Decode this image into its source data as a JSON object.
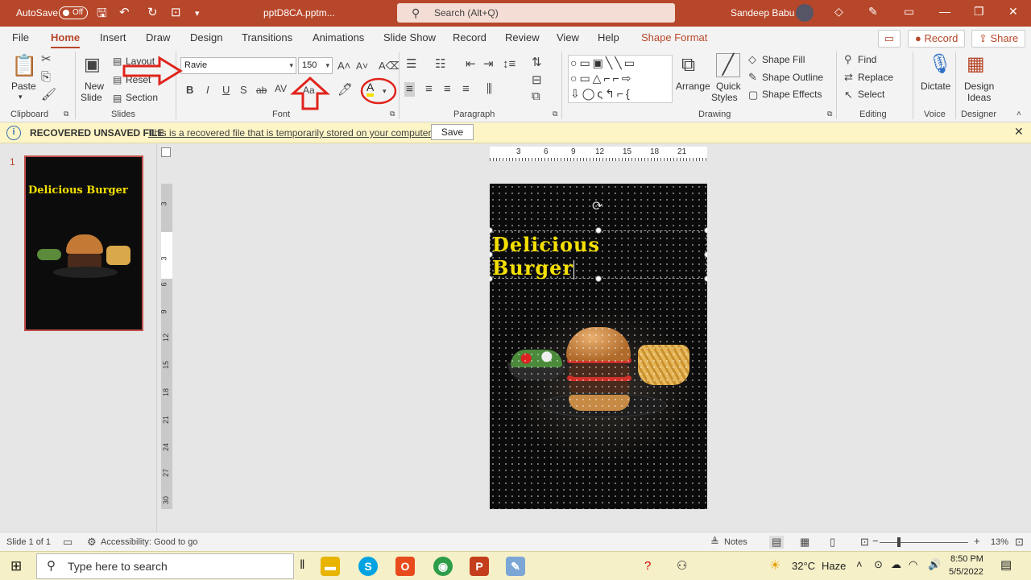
{
  "titlebar": {
    "autosave_label": "AutoSave",
    "autosave_state": "Off",
    "filename": "pptD8CA.pptm...",
    "search_placeholder": "Search (Alt+Q)",
    "user_name": "Sandeep Babu"
  },
  "tabs": [
    "File",
    "Home",
    "Insert",
    "Draw",
    "Design",
    "Transitions",
    "Animations",
    "Slide Show",
    "Record",
    "Review",
    "View",
    "Help",
    "Shape Format"
  ],
  "tab_actions": {
    "record": "Record",
    "share": "Share"
  },
  "ribbon": {
    "clipboard": {
      "paste": "Paste",
      "label": "Clipboard"
    },
    "slides": {
      "new_slide_1": "New",
      "new_slide_2": "Slide",
      "layout": "Layout",
      "reset": "Reset",
      "section": "Section",
      "label": "Slides"
    },
    "font": {
      "font_name": "Ravie",
      "font_size": "150",
      "label": "Font",
      "bold": "B",
      "italic": "I",
      "underline": "U",
      "shadow": "S",
      "strike": "ab",
      "spacing": "AV",
      "case": "Aa",
      "grow": "A^",
      "shrink": "Aˇ"
    },
    "paragraph": {
      "label": "Paragraph"
    },
    "drawing": {
      "arrange": "Arrange",
      "quick_styles_1": "Quick",
      "quick_styles_2": "Styles",
      "shape_fill": "Shape Fill",
      "shape_outline": "Shape Outline",
      "shape_effects": "Shape Effects",
      "label": "Drawing"
    },
    "editing": {
      "find": "Find",
      "replace": "Replace",
      "select": "Select",
      "label": "Editing"
    },
    "voice": {
      "dictate": "Dictate",
      "label": "Voice"
    },
    "designer": {
      "design_ideas_1": "Design",
      "design_ideas_2": "Ideas",
      "label": "Designer"
    }
  },
  "notification": {
    "title": "RECOVERED UNSAVED FILE",
    "message": "This is a recovered file that is temporarily stored on your computer.",
    "save": "Save"
  },
  "thumbnail": {
    "number": "1",
    "title": "Delicious Burger"
  },
  "hruler_numbers": [
    "3",
    "6",
    "9",
    "12",
    "15",
    "18",
    "21"
  ],
  "vruler_numbers": [
    "3",
    "3",
    "6",
    "9",
    "12",
    "15",
    "18",
    "21",
    "24",
    "27",
    "30"
  ],
  "slide": {
    "title_line1": "Delicious",
    "title_line2": "Burger"
  },
  "status": {
    "slide_info": "Slide 1 of 1",
    "accessibility": "Accessibility: Good to go",
    "notes": "Notes",
    "zoom": "13%"
  },
  "taskbar": {
    "search_placeholder": "Type here to search",
    "temperature": "32°C",
    "weather": "Haze",
    "time": "8:50 PM",
    "date": "5/5/2022"
  },
  "colors": {
    "accent": "#b7472a",
    "title_text": "#f5e000",
    "annotation": "#e0241c"
  }
}
